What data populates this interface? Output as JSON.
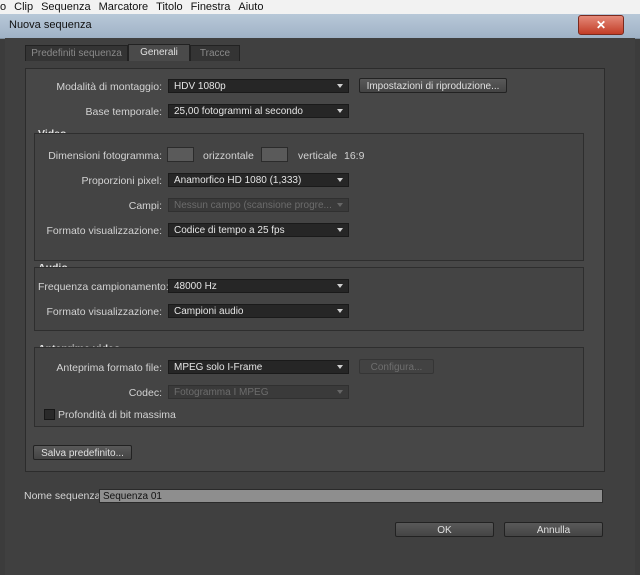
{
  "menu": [
    "o",
    "Clip",
    "Sequenza",
    "Marcatore",
    "Titolo",
    "Finestra",
    "Aiuto"
  ],
  "window": {
    "title": "Nuova sequenza",
    "close_glyph": "✕"
  },
  "tabs": [
    {
      "label": "Predefiniti sequenza",
      "active": false
    },
    {
      "label": "Generali",
      "active": true
    },
    {
      "label": "Tracce",
      "active": false
    }
  ],
  "general": {
    "editing_mode_label": "Modalità di montaggio:",
    "editing_mode_value": "HDV 1080p",
    "playback_settings_button": "Impostazioni di riproduzione...",
    "timebase_label": "Base temporale:",
    "timebase_value": "25,00 fotogrammi al secondo"
  },
  "video": {
    "title": "Video",
    "frame_size_label": "Dimensioni fotogramma:",
    "horizontal_label": "orizzontale",
    "vertical_label": "verticale",
    "aspect_ratio": "16:9",
    "pixel_aspect_label": "Proporzioni pixel:",
    "pixel_aspect_value": "Anamorfico HD 1080 (1,333)",
    "fields_label": "Campi:",
    "fields_value": "Nessun campo (scansione progre...",
    "display_format_label": "Formato visualizzazione:",
    "display_format_value": "Codice di tempo a 25 fps"
  },
  "audio": {
    "title": "Audio",
    "sample_rate_label": "Frequenza campionamento:",
    "sample_rate_value": "48000 Hz",
    "display_format_label": "Formato visualizzazione:",
    "display_format_value": "Campioni audio"
  },
  "previews": {
    "title": "Anteprime video",
    "file_format_label": "Anteprima formato file:",
    "file_format_value": "MPEG solo I-Frame",
    "configure_button": "Configura...",
    "codec_label": "Codec:",
    "codec_value": "Fotogramma I MPEG",
    "max_bit_depth_label": "Profondità di bit massima"
  },
  "save_preset_button": "Salva predefinito...",
  "sequence_name_label": "Nome sequenza:",
  "sequence_name_value": "Sequenza 01",
  "ok_button": "OK",
  "cancel_button": "Annulla",
  "colors": {
    "dialog_bg": "#404040",
    "panel_bg": "#474747",
    "dropdown_bg": "#262626",
    "titlebar": "#a9bccf",
    "close": "#c23d27"
  }
}
